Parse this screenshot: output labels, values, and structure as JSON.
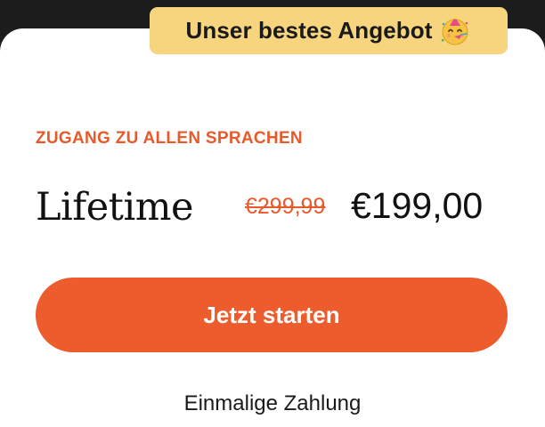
{
  "badge": {
    "label": "Unser bestes Angebot",
    "icon": "party-face-emoji-icon"
  },
  "plan": {
    "eyebrow": "ZUGANG ZU ALLEN SPRACHEN",
    "name": "Lifetime",
    "old_price": "€299,99",
    "price": "€199,00"
  },
  "cta": {
    "label": "Jetzt starten"
  },
  "footnote": "Einmalige Zahlung",
  "colors": {
    "accent": "#ec5c2c",
    "badge_bg": "#f7d57e",
    "background": "#1c1c1c",
    "card": "#ffffff"
  }
}
